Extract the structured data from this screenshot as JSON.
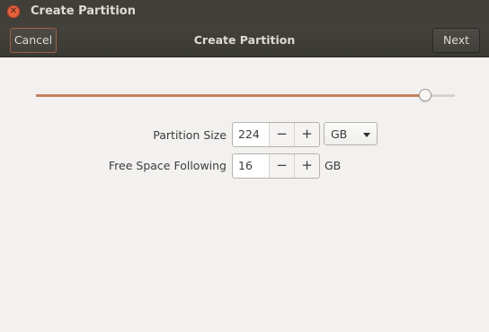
{
  "window": {
    "title": "Create Partition"
  },
  "header": {
    "cancel_label": "Cancel",
    "title": "Create Partition",
    "next_label": "Next"
  },
  "slider": {
    "fraction": 0.93
  },
  "form": {
    "partition_size": {
      "label": "Partition Size",
      "value": "224",
      "minus": "−",
      "plus": "+",
      "unit": "GB"
    },
    "free_space": {
      "label": "Free Space Following",
      "value": "16",
      "minus": "−",
      "plus": "+",
      "unit": "GB"
    }
  },
  "icons": {
    "close": "close-icon",
    "dropdown": "chevron-down-icon"
  },
  "colors": {
    "accent": "#c2825e",
    "titlebar": "#403f3a",
    "close": "#e95f38"
  }
}
